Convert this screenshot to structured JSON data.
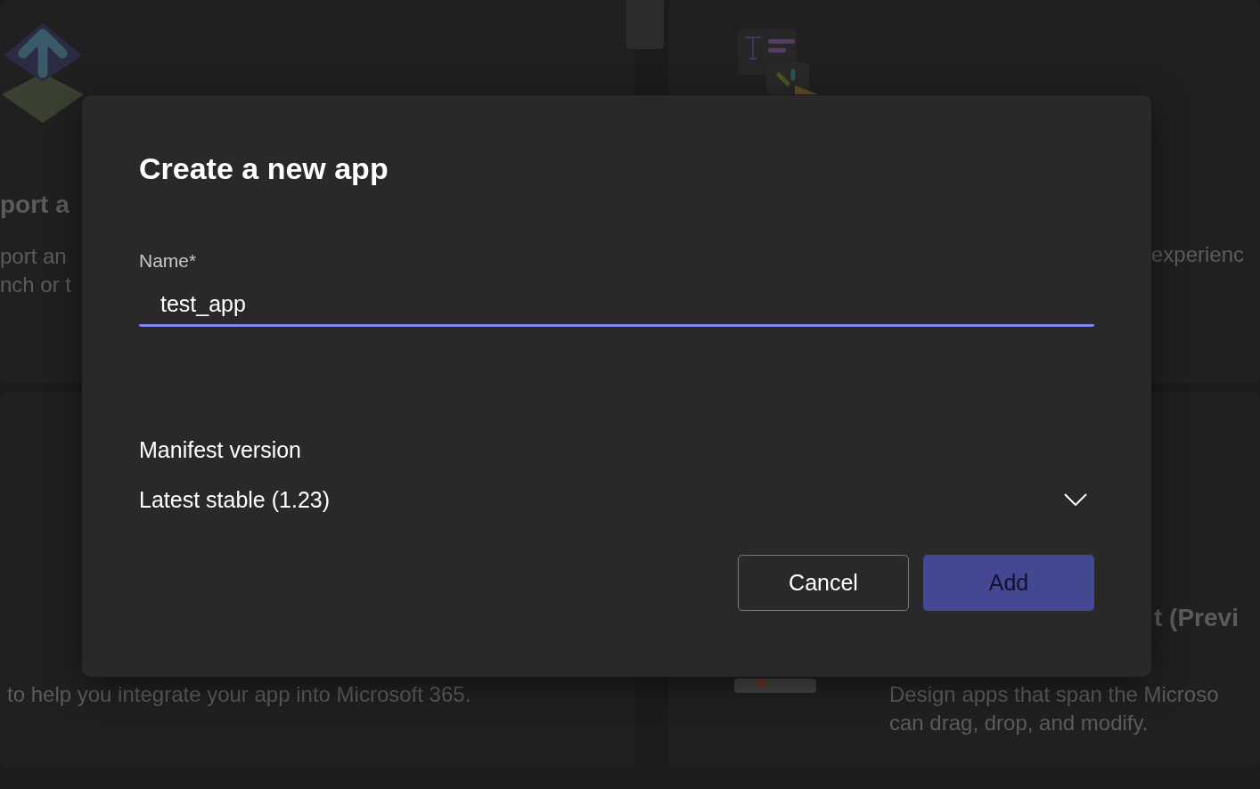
{
  "background": {
    "cards": [
      {
        "heading": "port a",
        "lines": [
          "port an",
          "nch or t"
        ]
      },
      {
        "lines": [
          "experienc"
        ]
      },
      {
        "lines": [
          "to help you integrate your app into Microsoft 365."
        ]
      },
      {
        "heading": "t (Previ",
        "lines": [
          "Design apps that span the Microso",
          "can drag, drop, and modify."
        ]
      }
    ]
  },
  "dialog": {
    "title": "Create a new app",
    "name_field": {
      "label": "Name*",
      "value": "test_app",
      "focused": true
    },
    "manifest_select": {
      "label": "Manifest version",
      "value": "Latest stable (1.23)"
    },
    "buttons": [
      {
        "label": "Cancel",
        "kind": "secondary"
      },
      {
        "label": "Add",
        "kind": "primary"
      }
    ]
  }
}
